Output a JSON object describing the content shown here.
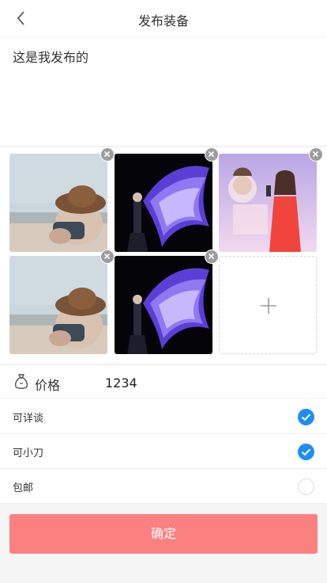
{
  "header": {
    "title": "发布装备",
    "back_icon": "chevron-left-icon"
  },
  "description": {
    "value": "这是我发布的",
    "placeholder": ""
  },
  "photos": [
    {
      "name": "photo-child-hat",
      "subject": "child with hat at beach"
    },
    {
      "name": "photo-singer-stage",
      "subject": "singer on stage with purple fabric"
    },
    {
      "name": "photo-singer-red-dress",
      "subject": "singer in red dress"
    },
    {
      "name": "photo-child-hat",
      "subject": "child with hat at beach"
    },
    {
      "name": "photo-singer-stage",
      "subject": "singer on stage with purple fabric"
    }
  ],
  "add_photo": {
    "icon": "plus-icon"
  },
  "price": {
    "icon": "money-bag-icon",
    "label": "价格",
    "value": "1234"
  },
  "options": [
    {
      "label": "可详谈",
      "checked": true
    },
    {
      "label": "可小刀",
      "checked": true
    },
    {
      "label": "包邮",
      "checked": false
    }
  ],
  "confirm_label": "确定",
  "colors": {
    "accent": "#1e8ef5",
    "button": "#fb8181",
    "background": "#f5f5f5"
  }
}
